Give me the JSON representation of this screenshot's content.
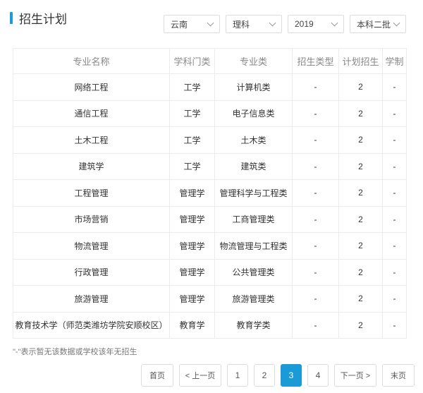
{
  "colors": {
    "accent": "#1a9bd7",
    "border": "#ececec"
  },
  "header": {
    "title": "招生计划"
  },
  "filters": [
    {
      "value": "云南",
      "icon": "chevron-down-icon"
    },
    {
      "value": "理科",
      "icon": "chevron-down-icon"
    },
    {
      "value": "2019",
      "icon": "chevron-down-icon"
    },
    {
      "value": "本科二批",
      "icon": "chevron-down-icon"
    }
  ],
  "table": {
    "headers": [
      "专业名称",
      "学科门类",
      "专业类",
      "招生类型",
      "计划招生",
      "学制"
    ],
    "rows": [
      [
        "网络工程",
        "工学",
        "计算机类",
        "-",
        "2",
        "-"
      ],
      [
        "通信工程",
        "工学",
        "电子信息类",
        "-",
        "2",
        "-"
      ],
      [
        "土木工程",
        "工学",
        "土木类",
        "-",
        "2",
        "-"
      ],
      [
        "建筑学",
        "工学",
        "建筑类",
        "-",
        "2",
        "-"
      ],
      [
        "工程管理",
        "管理学",
        "管理科学与工程类",
        "-",
        "2",
        "-"
      ],
      [
        "市场营销",
        "管理学",
        "工商管理类",
        "-",
        "2",
        "-"
      ],
      [
        "物流管理",
        "管理学",
        "物流管理与工程类",
        "-",
        "2",
        "-"
      ],
      [
        "行政管理",
        "管理学",
        "公共管理类",
        "-",
        "2",
        "-"
      ],
      [
        "旅游管理",
        "管理学",
        "旅游管理类",
        "-",
        "2",
        "-"
      ],
      [
        "教育技术学（师范类潍坊学院安顺校区）",
        "教育学",
        "教育学类",
        "-",
        "2",
        "-"
      ]
    ]
  },
  "footnote": "\"-\"表示暂无该数据或学校该年无招生",
  "pagination": {
    "first": "首页",
    "prev": "< 上一页",
    "pages": [
      "1",
      "2",
      "3",
      "4"
    ],
    "current": "3",
    "next": "下一页 >",
    "last": "末页"
  }
}
